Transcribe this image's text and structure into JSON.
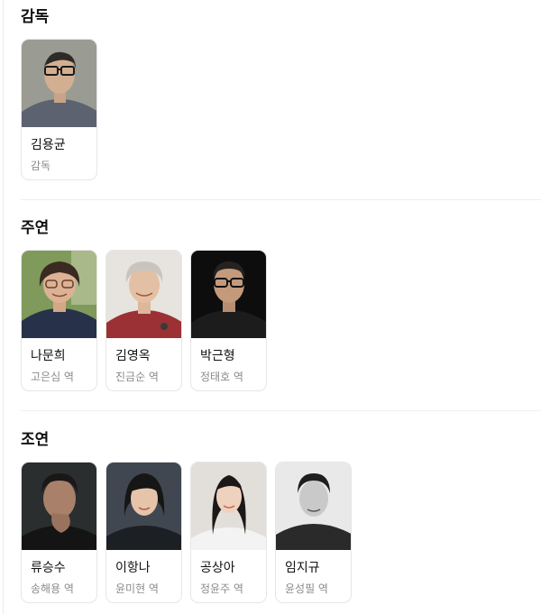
{
  "sections": [
    {
      "title": "감독",
      "people": [
        {
          "name": "김용균",
          "role": "감독"
        }
      ]
    },
    {
      "title": "주연",
      "people": [
        {
          "name": "나문희",
          "role": "고은심 역"
        },
        {
          "name": "김영옥",
          "role": "진금순 역"
        },
        {
          "name": "박근형",
          "role": "정태호 역"
        }
      ]
    },
    {
      "title": "조연",
      "people": [
        {
          "name": "류승수",
          "role": "송해용 역"
        },
        {
          "name": "이항나",
          "role": "윤미현 역"
        },
        {
          "name": "공상아",
          "role": "정윤주 역"
        },
        {
          "name": "임지규",
          "role": "윤성필 역"
        }
      ]
    }
  ]
}
